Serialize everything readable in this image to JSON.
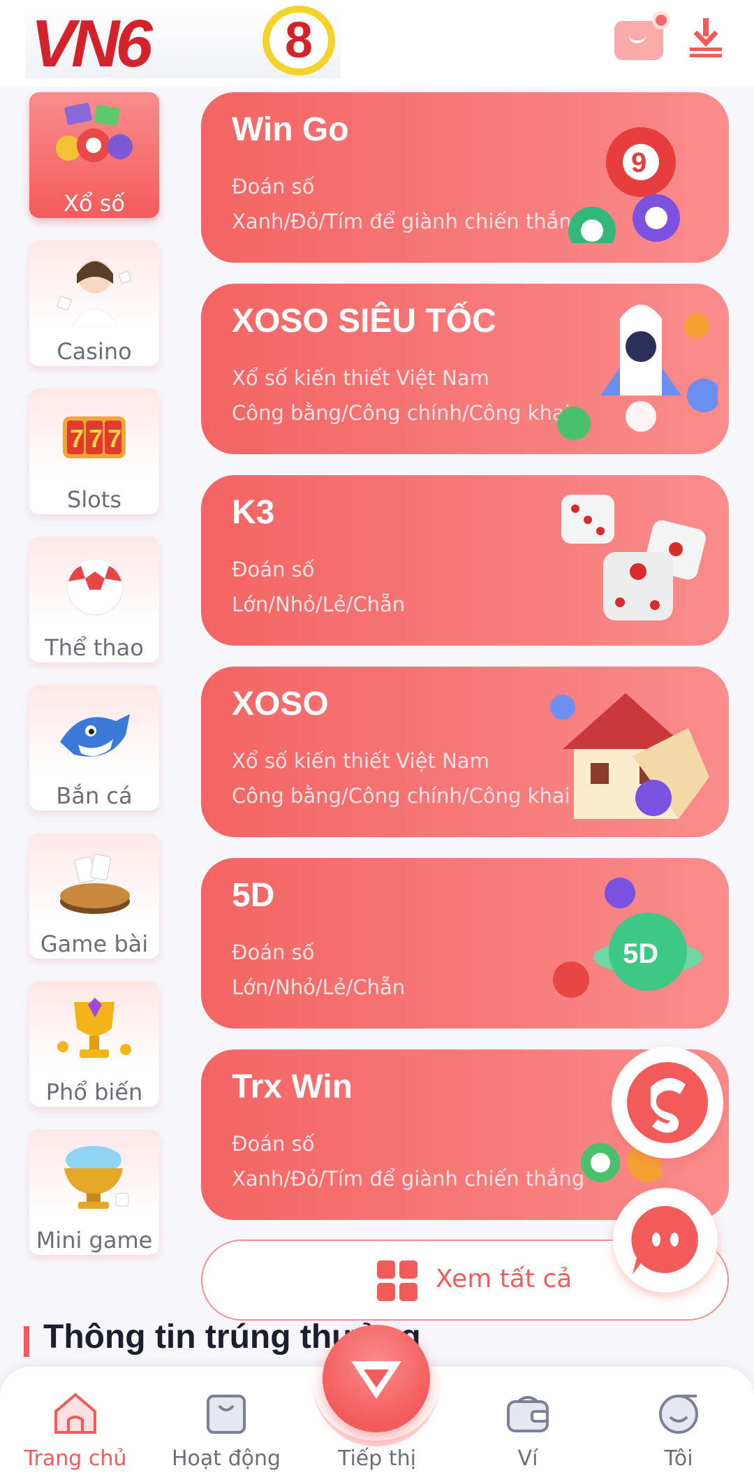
{
  "header": {
    "logo_text": "VN6",
    "logo_digit": "8",
    "icons": [
      "mail-icon",
      "download-icon"
    ]
  },
  "sidebar": {
    "items": [
      {
        "label": "Xổ số",
        "icon": "lottery-balls-icon",
        "active": true
      },
      {
        "label": "Casino",
        "icon": "casino-dealer-icon",
        "active": false
      },
      {
        "label": "Slots",
        "icon": "slots-777-icon",
        "active": false
      },
      {
        "label": "Thể thao",
        "icon": "soccer-ball-icon",
        "active": false
      },
      {
        "label": "Bắn cá",
        "icon": "shark-icon",
        "active": false
      },
      {
        "label": "Game bài",
        "icon": "card-table-icon",
        "active": false
      },
      {
        "label": "Phổ biến",
        "icon": "trophy-icon",
        "active": false
      },
      {
        "label": "Mini game",
        "icon": "gem-bowl-icon",
        "active": false
      }
    ]
  },
  "games": [
    {
      "title": "Win Go",
      "line1": "Đoán số",
      "line2": "Xanh/Đỏ/Tím để giành chiến thắng",
      "art": "lottery-balls-art"
    },
    {
      "title": "XOSO SIÊU TỐC",
      "line1": "Xổ số kiến thiết Việt Nam",
      "line2": "Công bằng/Công chính/Công khai",
      "art": "rocket-art"
    },
    {
      "title": "K3",
      "line1": "Đoán số",
      "line2": "Lớn/Nhỏ/Lẻ/Chẵn",
      "art": "dice-art"
    },
    {
      "title": "XOSO",
      "line1": "Xổ số kiến thiết Việt Nam",
      "line2": "Công bằng/Công chính/Công khai",
      "art": "house-art"
    },
    {
      "title": "5D",
      "line1": "Đoán số",
      "line2": "Lớn/Nhỏ/Lẻ/Chẵn",
      "art": "5d-ball-art"
    },
    {
      "title": "Trx Win",
      "line1": "Đoán số",
      "line2": "Xanh/Đỏ/Tím để giành chiến thắng",
      "art": "trx-ball-art"
    }
  ],
  "view_all": {
    "label": "Xem tất cả"
  },
  "section": {
    "title": "Thông tin trúng thưởng"
  },
  "nav": {
    "items": [
      {
        "label": "Trang chủ",
        "icon": "home-icon",
        "active": true
      },
      {
        "label": "Hoạt động",
        "icon": "activity-bag-icon",
        "active": false
      },
      {
        "label": "Tiếp thị",
        "icon": "diamond-icon",
        "active": false
      },
      {
        "label": "Ví",
        "icon": "wallet-icon",
        "active": false
      },
      {
        "label": "Tôi",
        "icon": "profile-icon",
        "active": false
      }
    ]
  },
  "colors": {
    "accent": "#f35b5b",
    "card_start": "#f46464",
    "card_end": "#fa8c8c"
  }
}
